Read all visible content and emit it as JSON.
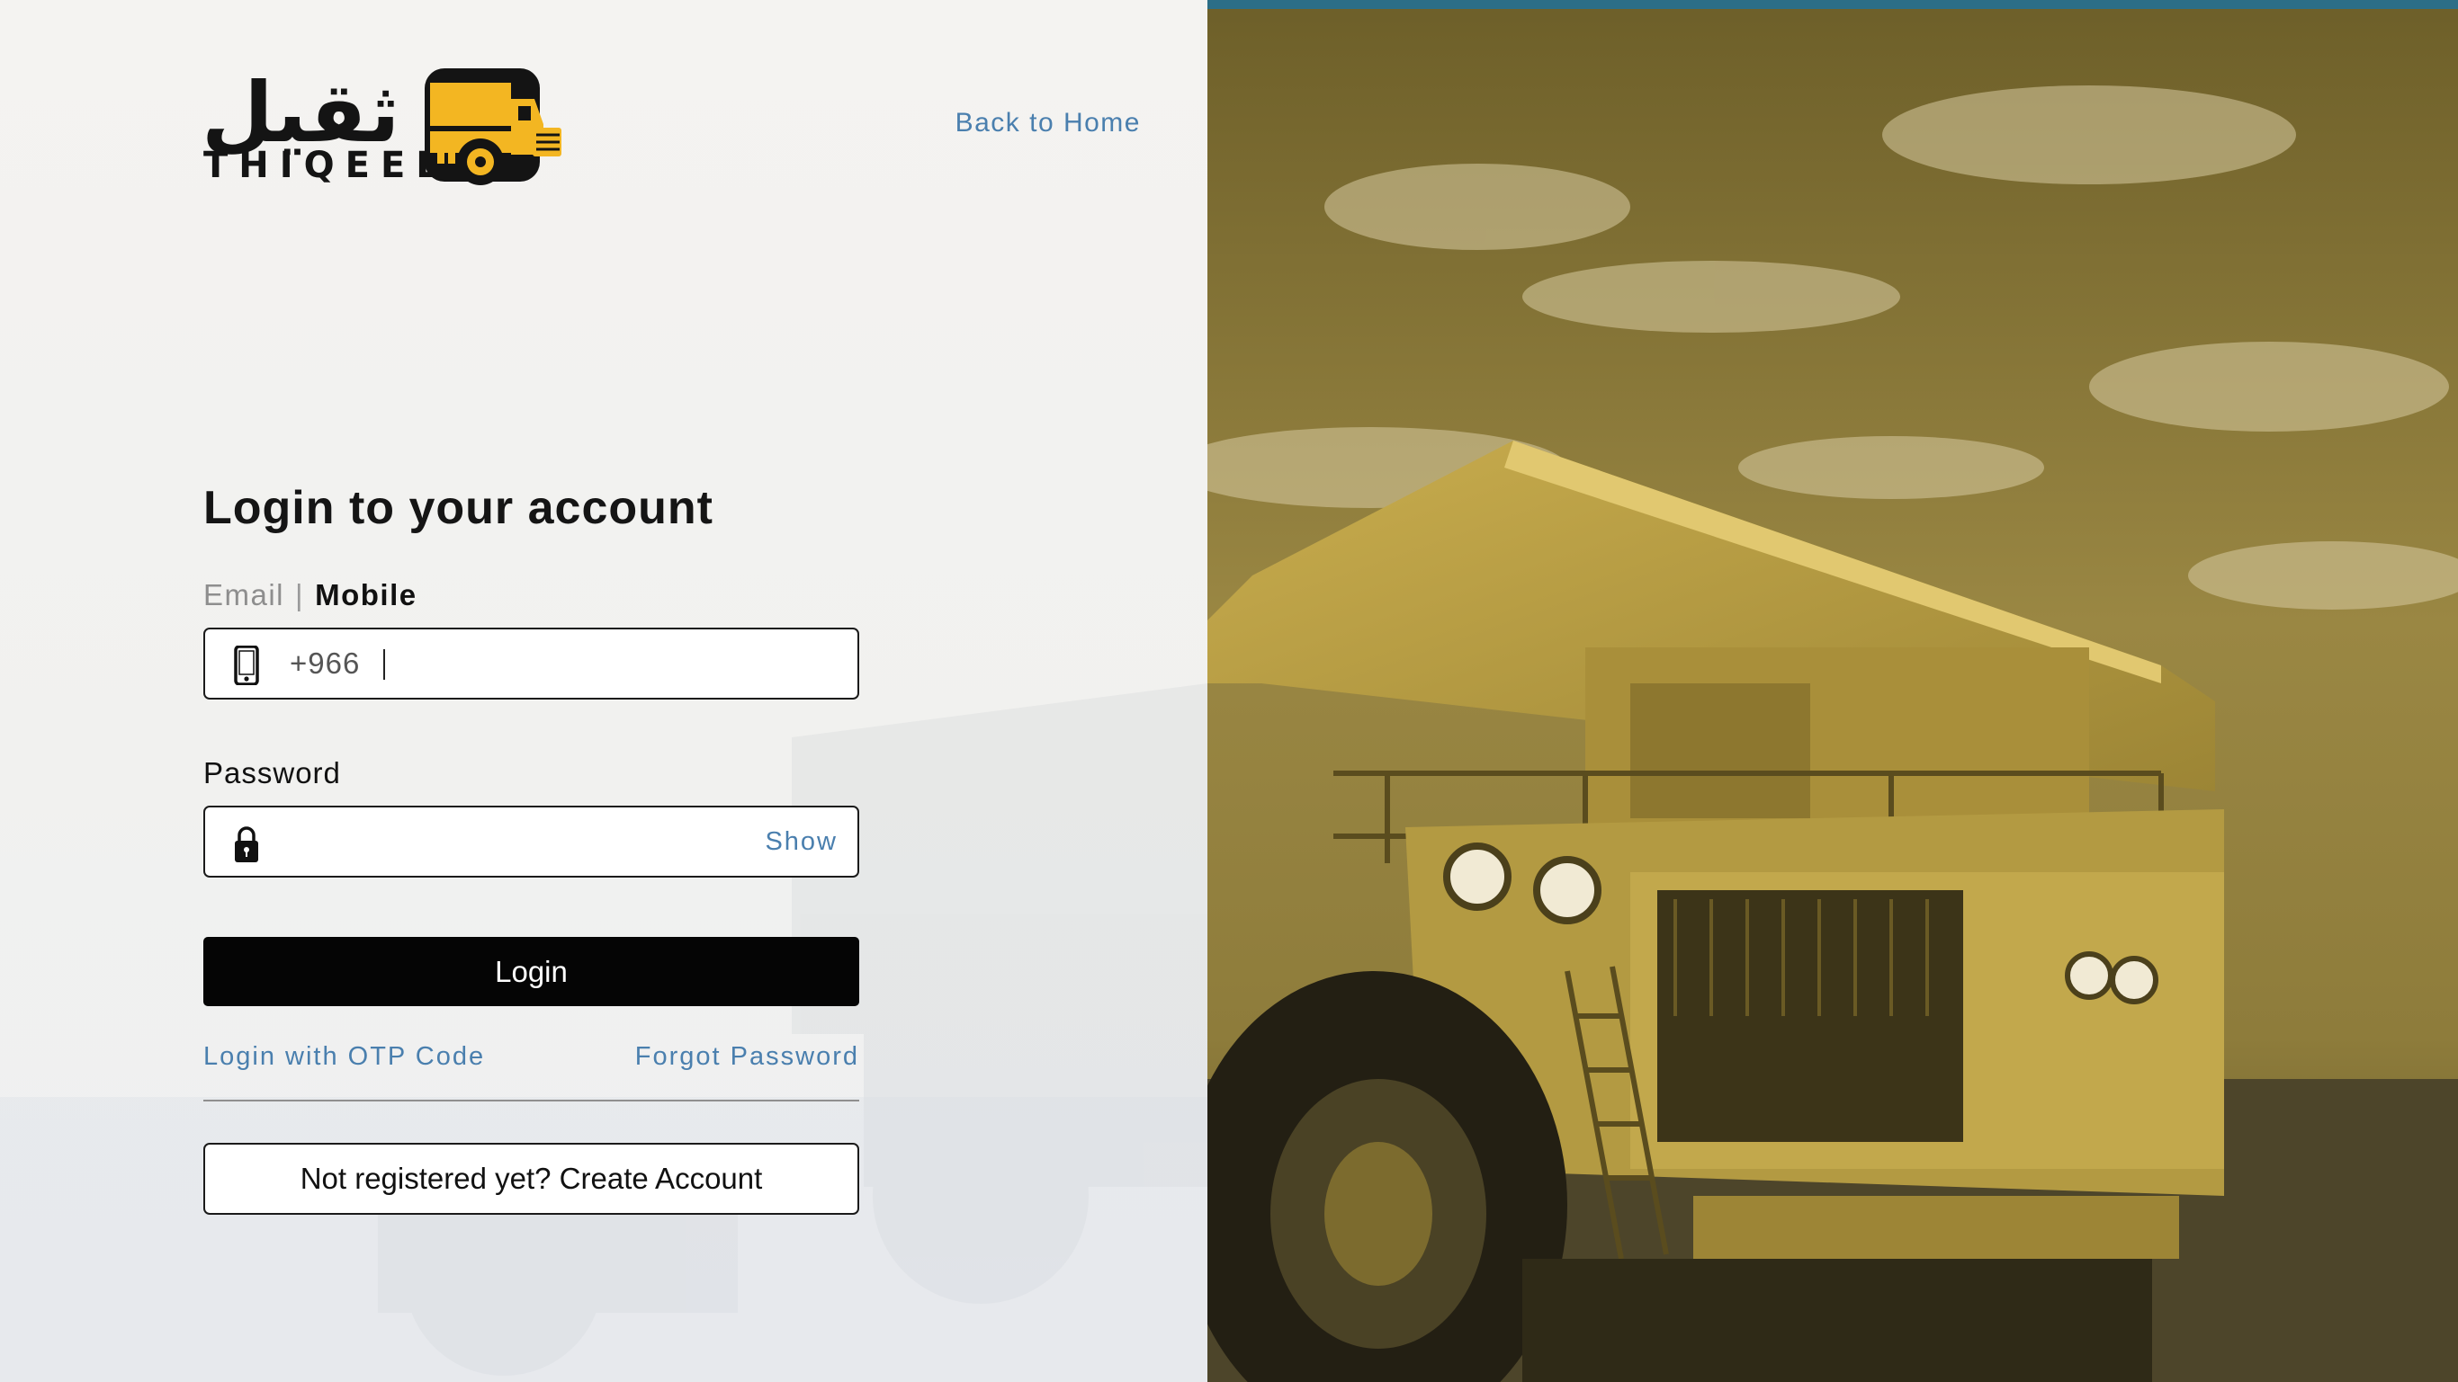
{
  "brand": {
    "arabic_name": "ثقيل",
    "latin_name": "THIQEEL"
  },
  "nav": {
    "back_home_label": "Back to Home"
  },
  "login_form": {
    "title": "Login to your account",
    "mode_email_label": "Email",
    "mode_separator": "|",
    "mode_mobile_label": "Mobile",
    "active_mode": "Mobile",
    "mobile_prefix": "+966",
    "mobile_value": "",
    "password_label": "Password",
    "password_value": "",
    "show_password_label": "Show",
    "login_button_label": "Login",
    "otp_link_label": "Login with OTP Code",
    "forgot_password_label": "Forgot Password",
    "register_button_label": "Not registered yet? Create Account"
  },
  "icons": {
    "mobile_field": "phone-icon",
    "password_field": "lock-icon",
    "logo": "dump-truck-logo-icon",
    "hero": "mining-dump-truck-photo"
  },
  "colors": {
    "link_blue": "#4a7fae",
    "brand_yellow": "#f3b622",
    "hero_tint": "#8c7a38",
    "top_accent": "#2c6e87",
    "button_black": "#050505"
  }
}
